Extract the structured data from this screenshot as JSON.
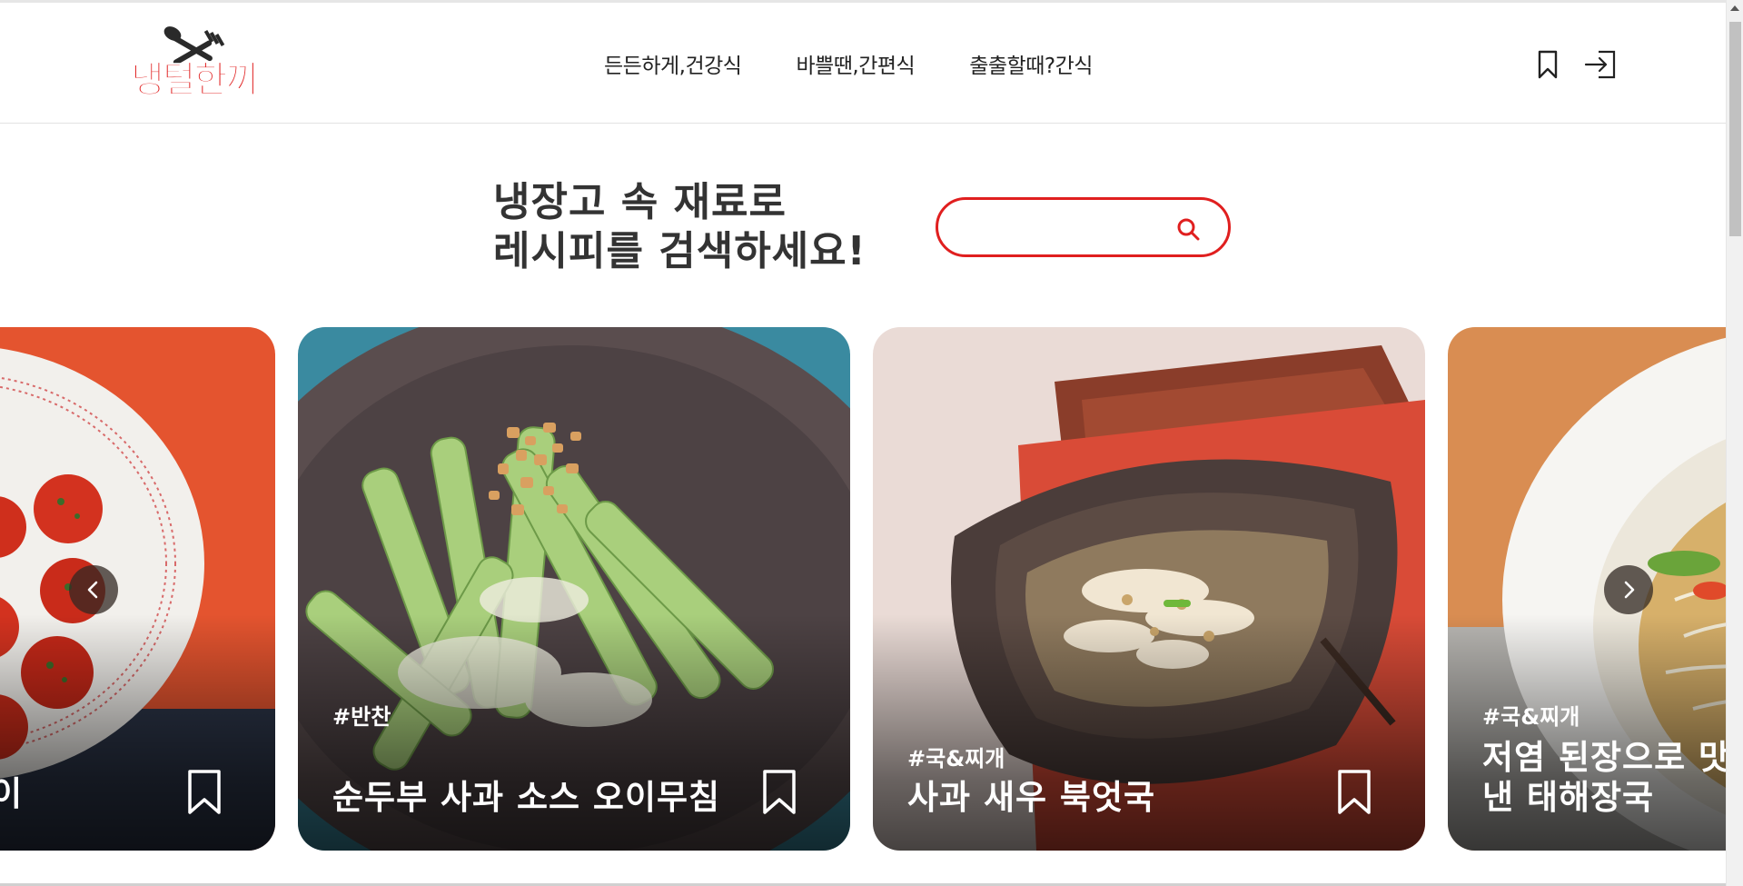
{
  "header": {
    "logo_text": "냉털한끼",
    "nav": [
      "든든하게,건강식",
      "바쁠땐,간편식",
      "출출할때?간식"
    ],
    "icons": [
      "bookmark-icon",
      "login-icon"
    ]
  },
  "hero": {
    "line1": "냉장고 속 재료로",
    "line2": "레시피를 검색하세요!",
    "search_placeholder": "",
    "search_icon": "search-icon",
    "accent_color": "#e01f1f"
  },
  "carousel": {
    "cards": [
      {
        "tag": "",
        "title": "...이",
        "icon": "bookmark-outline-icon"
      },
      {
        "tag": "#반찬",
        "title": "순두부 사과 소스 오이무침",
        "icon": "bookmark-outline-icon"
      },
      {
        "tag": "#국&찌개",
        "title": "사과 새우 북엇국",
        "icon": "bookmark-outline-icon"
      },
      {
        "tag": "#국&찌개",
        "title": "저염 된장으로 맛낸 태해장국",
        "icon": "bookmark-outline-icon"
      }
    ],
    "prev_icon": "chevron-left-icon",
    "next_icon": "chevron-right-icon"
  }
}
